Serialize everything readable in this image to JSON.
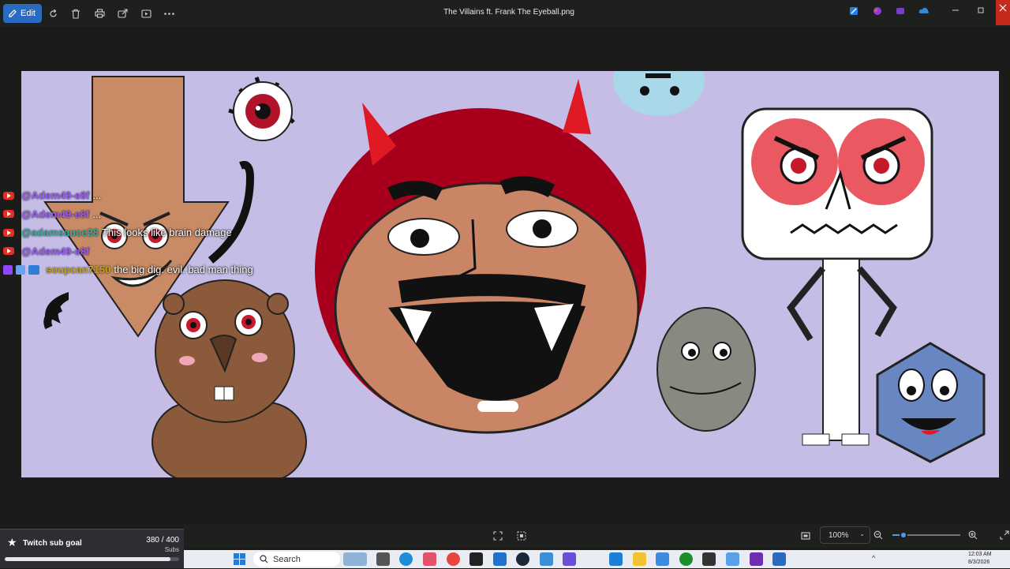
{
  "toolbar": {
    "edit_label": "Edit",
    "title": "The Villains ft. Frank The Eyeball.png",
    "icons": [
      "rotate-icon",
      "delete-icon",
      "print-icon",
      "share-icon",
      "slideshow-icon",
      "more-icon"
    ]
  },
  "chat": [
    {
      "user": "@Adem49-e8f",
      "message": "...",
      "user_color": "#9b5cf0"
    },
    {
      "user": "@Adem49-e8f",
      "message": "...",
      "user_color": "#9b5cf0"
    },
    {
      "user": "@adamsauce28",
      "message": "This looks like brain damage",
      "user_color": "#3fa9a0"
    },
    {
      "user": "@Adem49-e8f",
      "message": "",
      "user_color": "#9b5cf0"
    },
    {
      "user": "soupcan7150",
      "message": "the big dig. evil. bad man thing",
      "user_color": "#c7a21a"
    }
  ],
  "subgoal": {
    "label": "Twitch sub goal",
    "count": "380 / 400",
    "unit": "Subs",
    "progress": 0.95
  },
  "bottom": {
    "zoom": "100%"
  },
  "taskbar": {
    "search_placeholder": "Search",
    "time": "12:03 AM",
    "date": "8/3/2026"
  },
  "colors": {
    "canvas_bg": "#c5bde6",
    "accent": "#2a6ac0"
  }
}
